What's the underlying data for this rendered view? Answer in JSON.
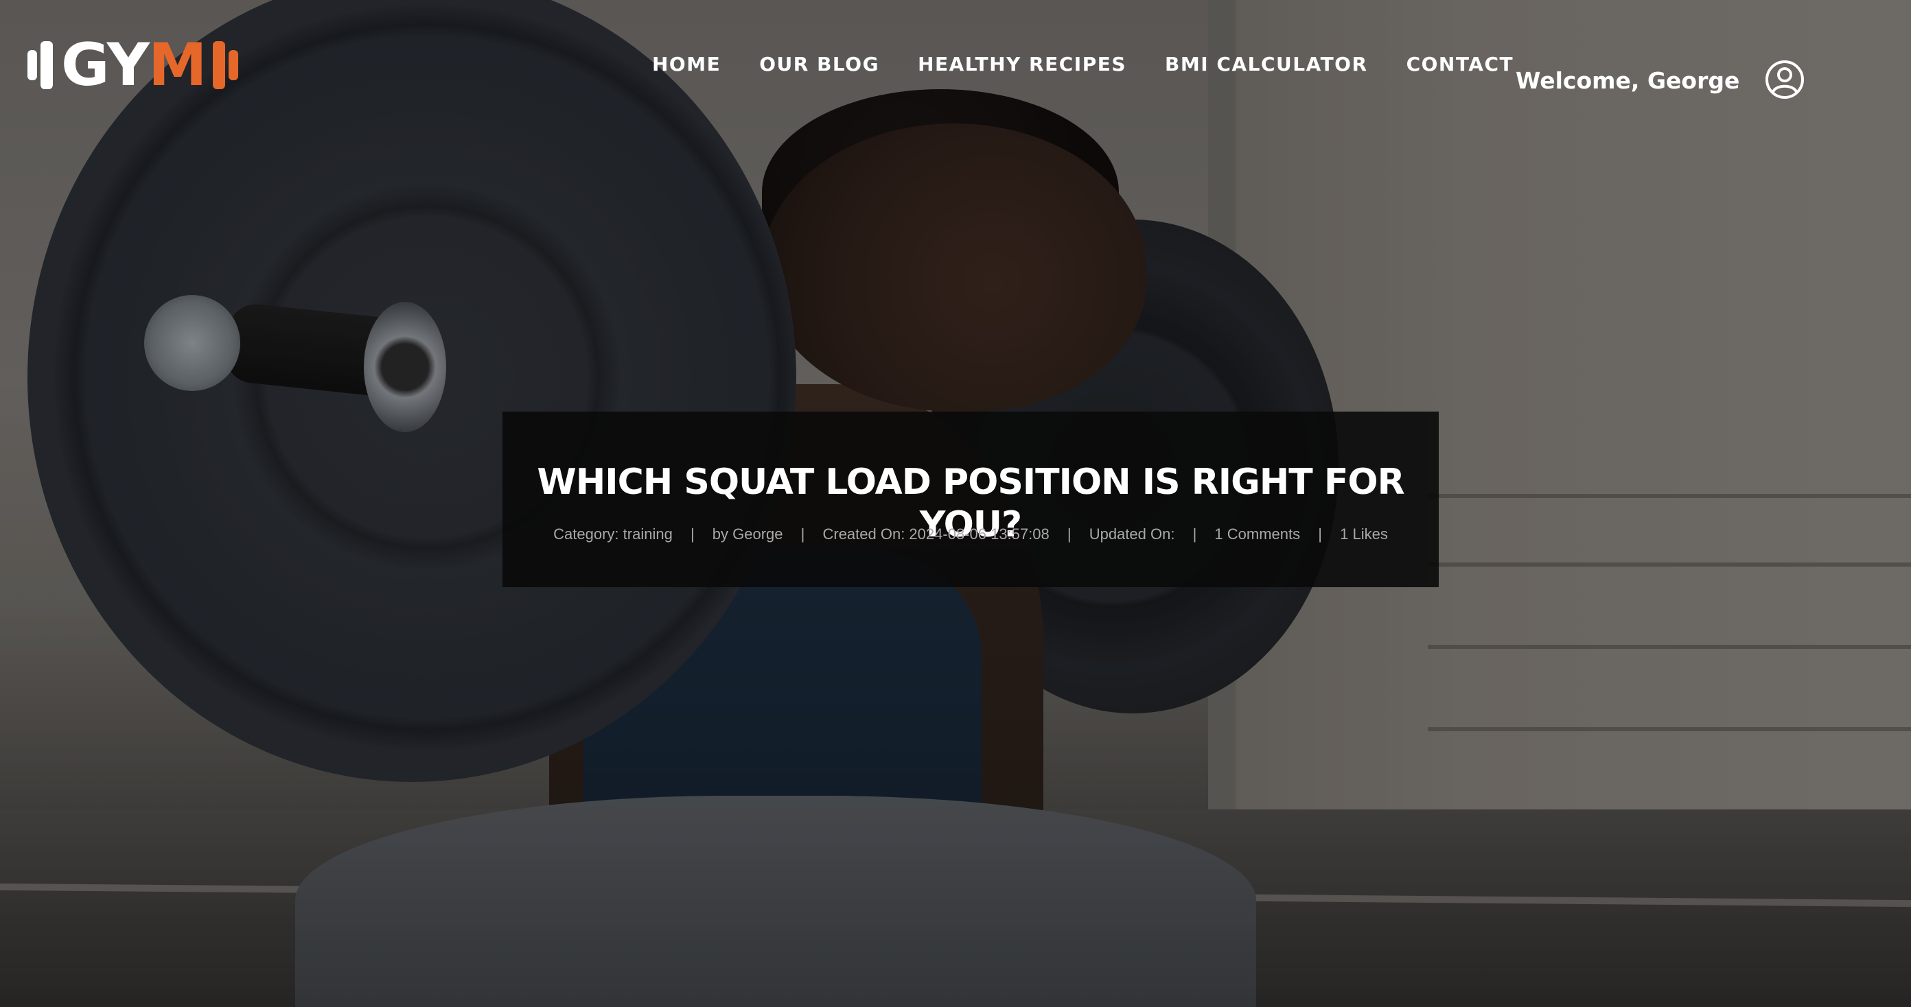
{
  "header": {
    "logo": {
      "text_white": "GY",
      "text_orange": "M"
    },
    "nav": [
      {
        "label": "HOME"
      },
      {
        "label": "OUR BLOG"
      },
      {
        "label": "HEALTHY RECIPES"
      },
      {
        "label": "BMI CALCULATOR"
      },
      {
        "label": "CONTACT"
      }
    ],
    "welcome": "Welcome, George",
    "user_icon": "user-circle-icon"
  },
  "post": {
    "title": "WHICH SQUAT LOAD POSITION IS RIGHT FOR YOU?",
    "meta": {
      "category": "Category: training",
      "author": "by George",
      "created": "Created On: 2024-08-06 13:57:08",
      "updated": "Updated On:",
      "comments": "1 Comments",
      "likes": "1 Likes",
      "separator": "|"
    }
  },
  "colors": {
    "accent": "#e5672a",
    "card_bg": "#0a0a0a",
    "text": "#ffffff",
    "meta_text": "#a9a9a9"
  }
}
